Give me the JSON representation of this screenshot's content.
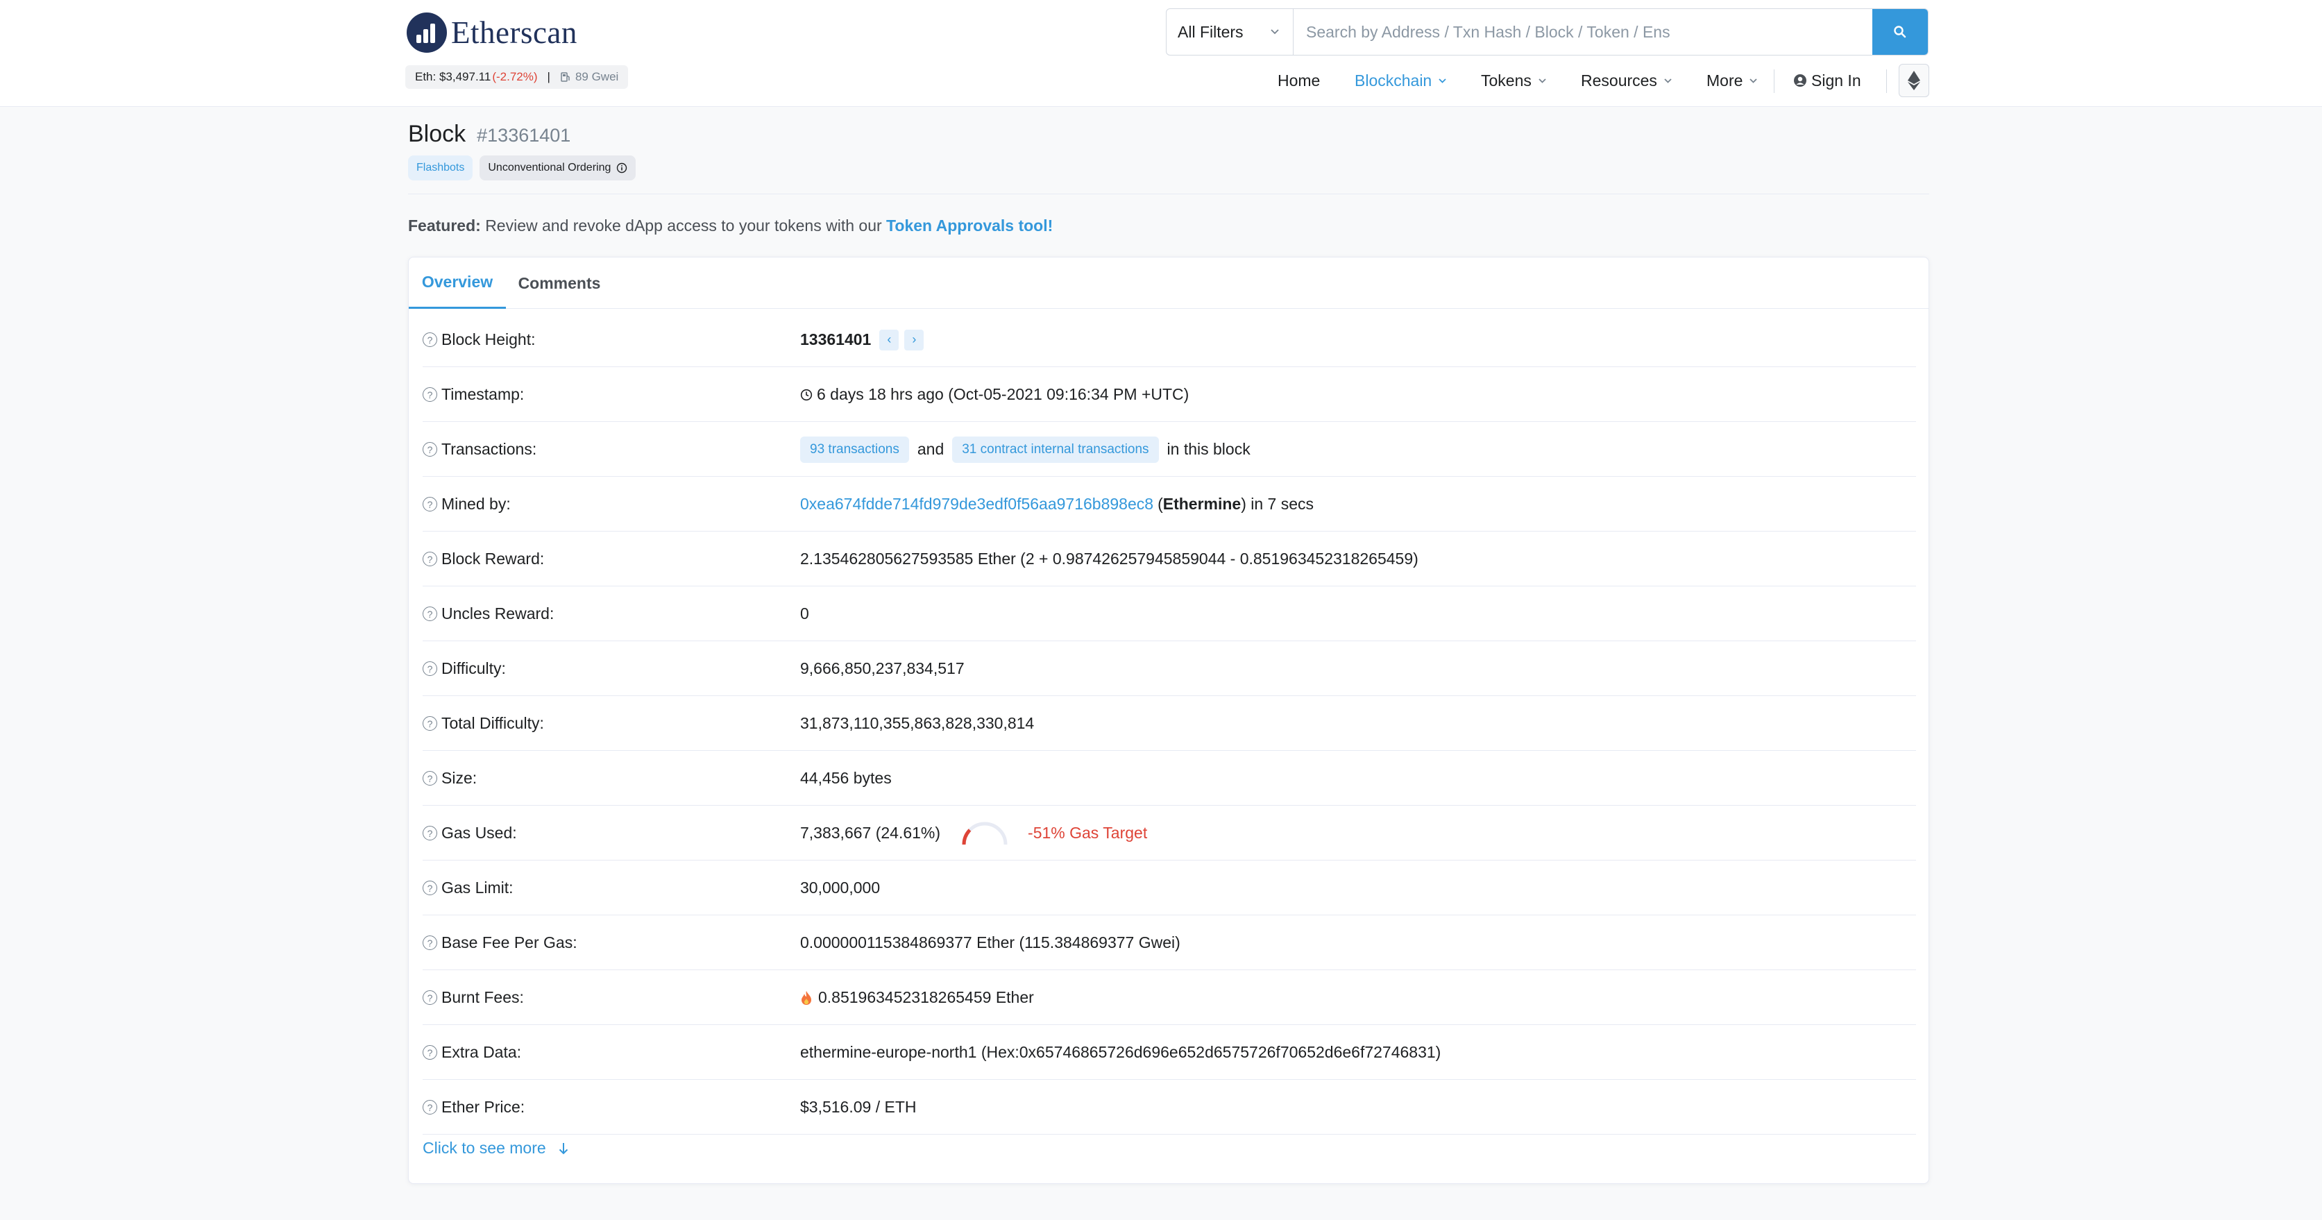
{
  "header": {
    "logo_text": "Etherscan",
    "eth_price_label": "Eth: $3,497.11",
    "eth_price_change": "(-2.72%)",
    "separator": "|",
    "gas_price": "89 Gwei",
    "search": {
      "filter_label": "All Filters",
      "placeholder": "Search by Address / Txn Hash / Block / Token / Ens"
    },
    "nav": {
      "home": "Home",
      "blockchain": "Blockchain",
      "tokens": "Tokens",
      "resources": "Resources",
      "more": "More",
      "sign_in": "Sign In"
    }
  },
  "page": {
    "title": "Block",
    "block_number": "#13361401",
    "badges": {
      "flashbots": "Flashbots",
      "ordering": "Unconventional Ordering"
    },
    "featured": {
      "prefix": "Featured:",
      "text": "Review and revoke dApp access to your tokens with our",
      "link": "Token Approvals tool!"
    }
  },
  "tabs": {
    "overview": "Overview",
    "comments": "Comments"
  },
  "overview": {
    "block_height": {
      "label": "Block Height:",
      "value": "13361401"
    },
    "timestamp": {
      "label": "Timestamp:",
      "value": "6 days 18 hrs ago (Oct-05-2021 09:16:34 PM +UTC)"
    },
    "transactions": {
      "label": "Transactions:",
      "tx_pill": "93 transactions",
      "and": "and",
      "internal_pill": "31 contract internal transactions",
      "suffix": "in this block"
    },
    "mined_by": {
      "label": "Mined by:",
      "address": "0xea674fdde714fd979de3edf0f56aa9716b898ec8",
      "open_paren": "(",
      "miner_name": "Ethermine",
      "suffix": ") in 7 secs"
    },
    "block_reward": {
      "label": "Block Reward:",
      "value": "2.135462805627593585 Ether (2 + 0.987426257945859044 - 0.851963452318265459)"
    },
    "uncles_reward": {
      "label": "Uncles Reward:",
      "value": "0"
    },
    "difficulty": {
      "label": "Difficulty:",
      "value": "9,666,850,237,834,517"
    },
    "total_difficulty": {
      "label": "Total Difficulty:",
      "value": "31,873,110,355,863,828,330,814"
    },
    "size": {
      "label": "Size:",
      "value": "44,456 bytes"
    },
    "gas_used": {
      "label": "Gas Used:",
      "value": "7,383,667 (24.61%)",
      "gauge_fraction": 0.2461,
      "gas_target": "-51% Gas Target"
    },
    "gas_limit": {
      "label": "Gas Limit:",
      "value": "30,000,000"
    },
    "base_fee": {
      "label": "Base Fee Per Gas:",
      "value": "0.000000115384869377 Ether (115.384869377 Gwei)"
    },
    "burnt_fees": {
      "label": "Burnt Fees:",
      "value": "0.851963452318265459 Ether"
    },
    "extra_data": {
      "label": "Extra Data:",
      "value": "ethermine-europe-north1 (Hex:0x65746865726d696e652d6575726f70652d6e6f72746831)"
    },
    "ether_price": {
      "label": "Ether Price:",
      "value": "$3,516.09 / ETH"
    },
    "see_more": "Click to see more"
  },
  "colors": {
    "accent": "#3498db",
    "danger": "#de4437",
    "brand": "#21325b"
  }
}
